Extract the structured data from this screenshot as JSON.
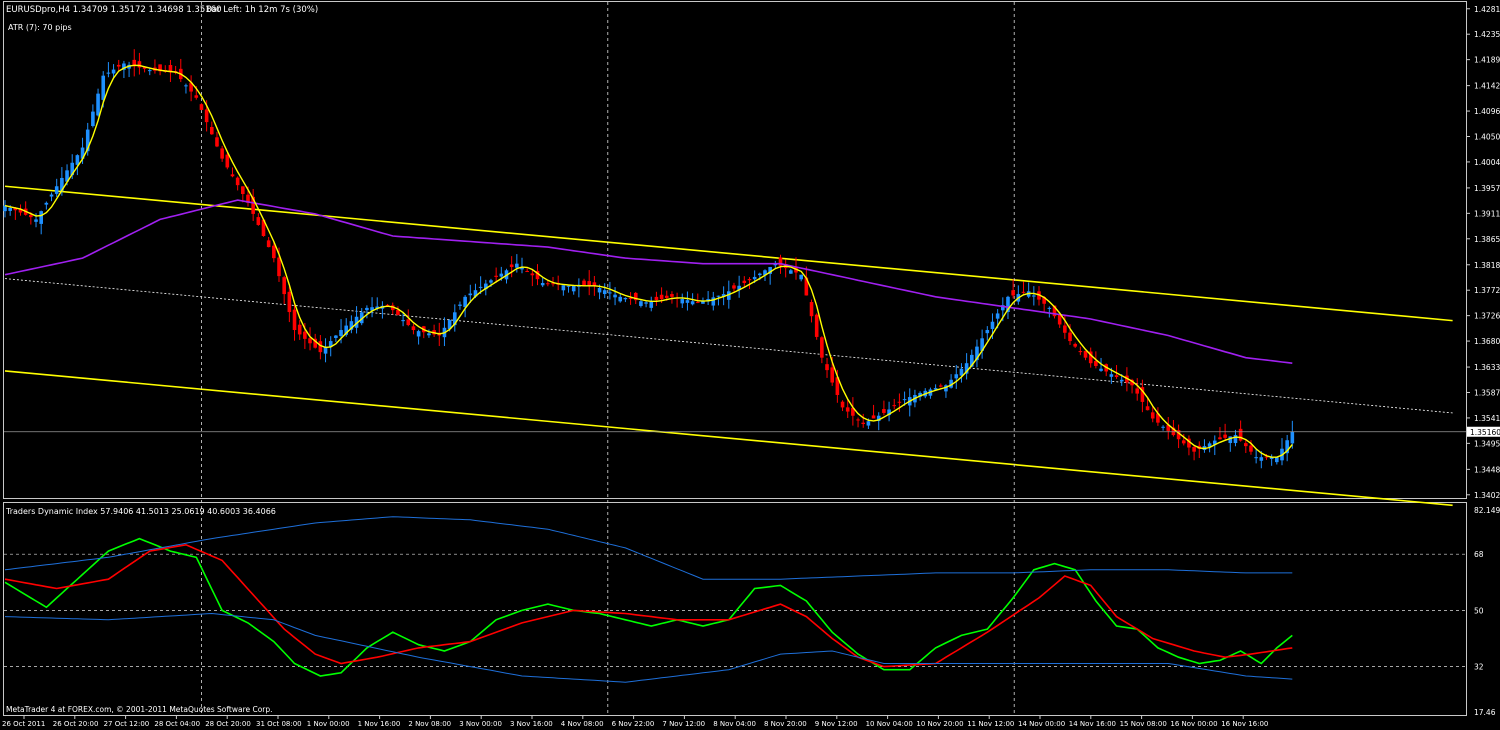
{
  "window": {
    "symbol_line": "EURUSDpro,H4  1.34709 1.35172 1.34698 1.35160",
    "bar_left": "Bar Left: 1h 12m 7s (30%)",
    "atr_label": "ATR (7):   70 pips",
    "indicator_line": "Traders Dynamic Index 57.9406 41.5013 25.0619 40.6003 36.4066",
    "copyright": "MetaTrader 4 at FOREX.com, © 2001-2011 MetaQuotes Software Corp."
  },
  "colors": {
    "background": "#000000",
    "bull_candle": "#1e90ff",
    "bear_candle": "#ff0000",
    "ma_fast": "#ffff00",
    "ma_slow": "#a020f0",
    "channel": "#ffff00",
    "tdi_green": "#00ff00",
    "tdi_red": "#ff0000",
    "tdi_band": "#1e6fd9",
    "text": "#ffffff"
  },
  "chart_data": [
    {
      "type": "candlestick",
      "title": "EURUSDpro,H4",
      "current_price": "1.35160",
      "y_ticks": [
        "1.42810",
        "1.42350",
        "1.41890",
        "1.41420",
        "1.40960",
        "1.40500",
        "1.40040",
        "1.39570",
        "1.39110",
        "1.38650",
        "1.38180",
        "1.37720",
        "1.37260",
        "1.36800",
        "1.36330",
        "1.35870",
        "1.35410",
        "1.34950",
        "1.34480",
        "1.34020"
      ],
      "ylim": [
        1.3398,
        1.4286
      ],
      "x_ticks": [
        "26 Oct 2011",
        "26 Oct 20:00",
        "27 Oct 12:00",
        "28 Oct 04:00",
        "28 Oct 20:00",
        "31 Oct 08:00",
        "1 Nov 00:00",
        "1 Nov 16:00",
        "2 Nov 08:00",
        "3 Nov 00:00",
        "3 Nov 16:00",
        "4 Nov 08:00",
        "6 Nov 22:00",
        "7 Nov 12:00",
        "8 Nov 04:00",
        "8 Nov 20:00",
        "9 Nov 12:00",
        "10 Nov 04:00",
        "10 Nov 20:00",
        "11 Nov 12:00",
        "14 Nov 00:00",
        "14 Nov 16:00",
        "15 Nov 08:00",
        "16 Nov 00:00",
        "16 Nov 16:00"
      ],
      "period_separators_after_tick": [
        "28 Oct 04:00",
        "4 Nov 08:00",
        "11 Nov 12:00"
      ],
      "close_keypoints": [
        [
          0,
          1.3925
        ],
        [
          6,
          1.39
        ],
        [
          11,
          1.3975
        ],
        [
          15,
          1.403
        ],
        [
          19,
          1.416
        ],
        [
          23,
          1.4182
        ],
        [
          28,
          1.417
        ],
        [
          33,
          1.4165
        ],
        [
          37,
          1.412
        ],
        [
          42,
          1.401
        ],
        [
          47,
          1.393
        ],
        [
          52,
          1.383
        ],
        [
          56,
          1.37
        ],
        [
          61,
          1.366
        ],
        [
          65,
          1.37
        ],
        [
          70,
          1.374
        ],
        [
          74,
          1.3745
        ],
        [
          79,
          1.37
        ],
        [
          84,
          1.369
        ],
        [
          89,
          1.376
        ],
        [
          94,
          1.379
        ],
        [
          99,
          1.382
        ],
        [
          104,
          1.3785
        ],
        [
          109,
          1.378
        ],
        [
          114,
          1.378
        ],
        [
          119,
          1.376
        ],
        [
          124,
          1.375
        ],
        [
          129,
          1.376
        ],
        [
          134,
          1.375
        ],
        [
          139,
          1.3765
        ],
        [
          144,
          1.379
        ],
        [
          149,
          1.382
        ],
        [
          154,
          1.38
        ],
        [
          158,
          1.365
        ],
        [
          162,
          1.356
        ],
        [
          166,
          1.353
        ],
        [
          170,
          1.355
        ],
        [
          174,
          1.3575
        ],
        [
          178,
          1.359
        ],
        [
          182,
          1.36
        ],
        [
          186,
          1.364
        ],
        [
          190,
          1.37
        ],
        [
          194,
          1.376
        ],
        [
          198,
          1.377
        ],
        [
          202,
          1.374
        ],
        [
          206,
          1.368
        ],
        [
          210,
          1.364
        ],
        [
          214,
          1.362
        ],
        [
          218,
          1.36
        ],
        [
          222,
          1.354
        ],
        [
          226,
          1.351
        ],
        [
          230,
          1.348
        ],
        [
          234,
          1.35
        ],
        [
          238,
          1.351
        ],
        [
          242,
          1.347
        ],
        [
          246,
          1.347
        ],
        [
          249,
          1.3516
        ]
      ],
      "ma_slow_keypoints": [
        [
          0,
          1.38
        ],
        [
          15,
          1.383
        ],
        [
          30,
          1.39
        ],
        [
          45,
          1.3935
        ],
        [
          60,
          1.391
        ],
        [
          75,
          1.387
        ],
        [
          90,
          1.386
        ],
        [
          105,
          1.385
        ],
        [
          120,
          1.383
        ],
        [
          135,
          1.382
        ],
        [
          150,
          1.382
        ],
        [
          165,
          1.379
        ],
        [
          180,
          1.376
        ],
        [
          195,
          1.374
        ],
        [
          210,
          1.372
        ],
        [
          225,
          1.369
        ],
        [
          240,
          1.365
        ],
        [
          249,
          1.364
        ]
      ],
      "channel_upper": [
        [
          0,
          1.396
        ],
        [
          280,
          1.3717
        ]
      ],
      "channel_lower": [
        [
          0,
          1.3626
        ],
        [
          280,
          1.3383
        ]
      ],
      "channel_mid": [
        [
          0,
          1.3793
        ],
        [
          280,
          1.355
        ]
      ],
      "bar_count": 250
    },
    {
      "type": "line",
      "title": "Traders Dynamic Index",
      "y_ticks": [
        "82.149",
        "68",
        "50",
        "32",
        "17.46"
      ],
      "ylim": [
        17.46,
        82.149
      ],
      "levels": [
        68,
        50,
        32
      ],
      "series": [
        {
          "name": "",
          "color": "#00ff00",
          "points": [
            [
              0,
              59
            ],
            [
              8,
              51
            ],
            [
              14,
              60
            ],
            [
              20,
              69
            ],
            [
              26,
              73
            ],
            [
              32,
              69
            ],
            [
              37,
              67
            ],
            [
              42,
              50
            ],
            [
              47,
              46
            ],
            [
              52,
              40
            ],
            [
              56,
              33
            ],
            [
              61,
              29
            ],
            [
              65,
              30
            ],
            [
              70,
              38
            ],
            [
              75,
              43
            ],
            [
              80,
              39
            ],
            [
              85,
              37
            ],
            [
              90,
              40
            ],
            [
              95,
              47
            ],
            [
              100,
              50
            ],
            [
              105,
              52
            ],
            [
              110,
              50
            ],
            [
              115,
              49
            ],
            [
              120,
              47
            ],
            [
              125,
              45
            ],
            [
              130,
              47
            ],
            [
              135,
              45
            ],
            [
              140,
              47
            ],
            [
              145,
              57
            ],
            [
              150,
              58
            ],
            [
              155,
              53
            ],
            [
              160,
              43
            ],
            [
              165,
              36
            ],
            [
              170,
              31
            ],
            [
              175,
              31
            ],
            [
              180,
              38
            ],
            [
              185,
              42
            ],
            [
              190,
              44
            ],
            [
              195,
              54
            ],
            [
              199,
              63
            ],
            [
              203,
              65
            ],
            [
              207,
              63
            ],
            [
              211,
              53
            ],
            [
              215,
              45
            ],
            [
              219,
              44
            ],
            [
              223,
              38
            ],
            [
              227,
              35
            ],
            [
              231,
              33
            ],
            [
              235,
              34
            ],
            [
              239,
              37
            ],
            [
              243,
              33
            ],
            [
              246,
              38
            ],
            [
              249,
              42
            ]
          ]
        },
        {
          "name": "",
          "color": "#ff0000",
          "points": [
            [
              0,
              60
            ],
            [
              10,
              57
            ],
            [
              20,
              60
            ],
            [
              28,
              69
            ],
            [
              35,
              71
            ],
            [
              42,
              66
            ],
            [
              48,
              55
            ],
            [
              54,
              44
            ],
            [
              60,
              36
            ],
            [
              65,
              33
            ],
            [
              72,
              35
            ],
            [
              80,
              38
            ],
            [
              90,
              40
            ],
            [
              100,
              46
            ],
            [
              110,
              50
            ],
            [
              120,
              49
            ],
            [
              130,
              47
            ],
            [
              140,
              47
            ],
            [
              150,
              52
            ],
            [
              155,
              48
            ],
            [
              160,
              41
            ],
            [
              165,
              35
            ],
            [
              170,
              32
            ],
            [
              180,
              33
            ],
            [
              190,
              43
            ],
            [
              200,
              54
            ],
            [
              205,
              61
            ],
            [
              210,
              58
            ],
            [
              215,
              48
            ],
            [
              222,
              41
            ],
            [
              230,
              37
            ],
            [
              236,
              35
            ],
            [
              241,
              36
            ],
            [
              249,
              38
            ]
          ]
        },
        {
          "name": "",
          "color": "#1e6fd9",
          "points": [
            [
              0,
              63
            ],
            [
              20,
              67
            ],
            [
              40,
              73
            ],
            [
              60,
              78
            ],
            [
              75,
              80
            ],
            [
              90,
              79
            ],
            [
              105,
              76
            ],
            [
              120,
              70
            ],
            [
              135,
              60
            ],
            [
              150,
              60
            ],
            [
              165,
              61
            ],
            [
              180,
              62
            ],
            [
              195,
              62
            ],
            [
              210,
              63
            ],
            [
              225,
              63
            ],
            [
              240,
              62
            ],
            [
              249,
              62
            ]
          ]
        },
        {
          "name": "",
          "color": "#1e6fd9",
          "points": [
            [
              0,
              48
            ],
            [
              20,
              47
            ],
            [
              40,
              49
            ],
            [
              52,
              47
            ],
            [
              60,
              42
            ],
            [
              80,
              35
            ],
            [
              100,
              29
            ],
            [
              120,
              27
            ],
            [
              140,
              31
            ],
            [
              150,
              36
            ],
            [
              160,
              37
            ],
            [
              170,
              33
            ],
            [
              180,
              33
            ],
            [
              195,
              33
            ],
            [
              210,
              33
            ],
            [
              225,
              33
            ],
            [
              240,
              29
            ],
            [
              249,
              28
            ]
          ]
        }
      ]
    }
  ]
}
